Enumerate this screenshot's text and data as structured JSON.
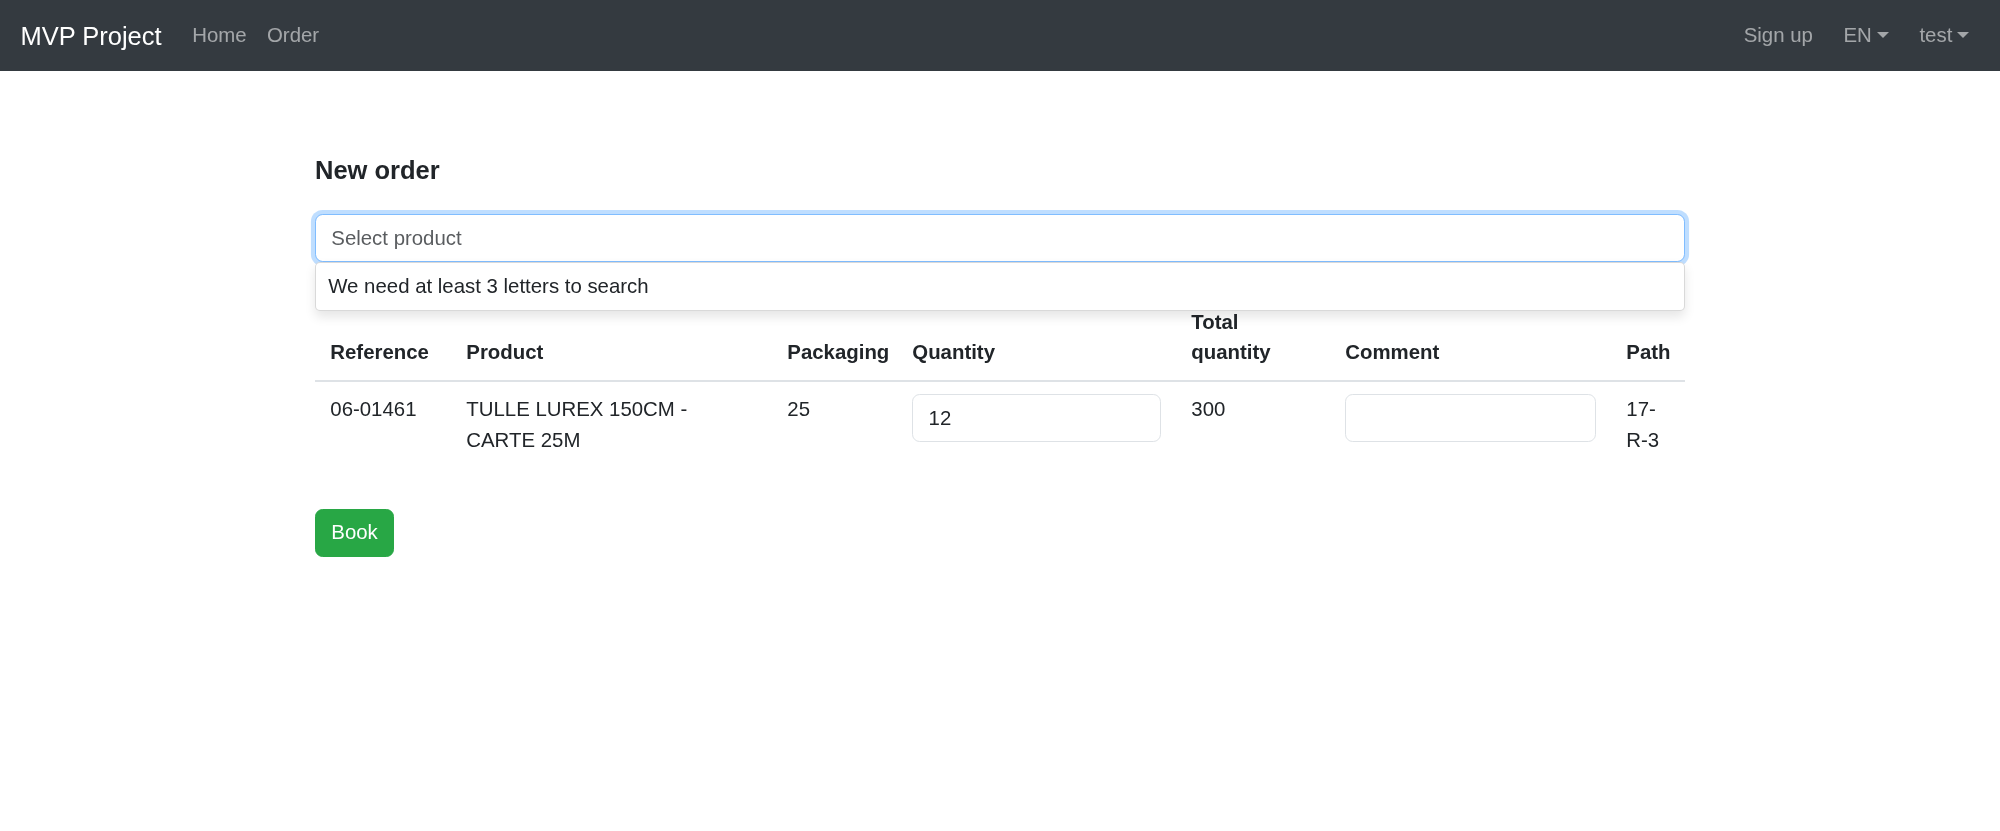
{
  "navbar": {
    "brand": "MVP Project",
    "links": [
      {
        "label": "Home",
        "selected": false
      },
      {
        "label": "Order",
        "selected": false
      }
    ],
    "right": [
      {
        "label": "Sign up",
        "kind": "link"
      },
      {
        "label": "EN",
        "kind": "dropdown"
      },
      {
        "label": "test",
        "kind": "dropdown"
      }
    ]
  },
  "title": "New order",
  "search": {
    "placeholder": "Select product",
    "focused": true,
    "hint": "We need at least 3 letters to search"
  },
  "table": {
    "columns": [
      "Reference",
      "Product",
      "Packaging",
      "Quantity",
      "Total quantity",
      "Comment",
      "Path"
    ],
    "rows": [
      {
        "cells": [
          {
            "kind": "text",
            "value": "06-01461"
          },
          {
            "kind": "text",
            "value": "TULLE LUREX 150CM - CARTE 25M"
          },
          {
            "kind": "text",
            "value": "25"
          },
          {
            "kind": "input",
            "value": "12"
          },
          {
            "kind": "text",
            "value": "300"
          },
          {
            "kind": "input"
          },
          {
            "kind": "text",
            "value": "17-R-3"
          }
        ]
      }
    ]
  },
  "button": "Book"
}
